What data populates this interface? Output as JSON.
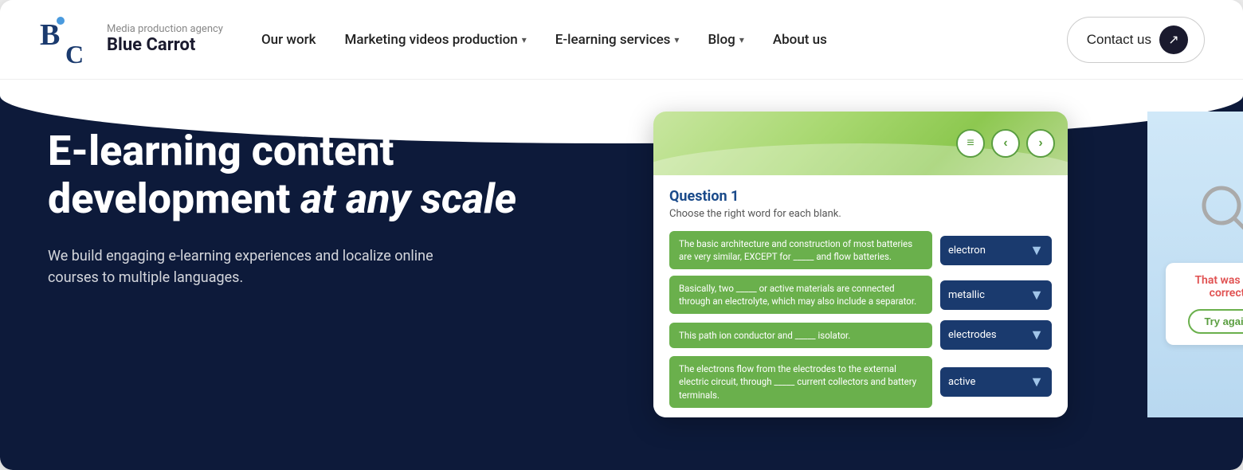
{
  "navbar": {
    "logo": {
      "subtitle": "Media production agency",
      "title": "Blue Carrot"
    },
    "links": [
      {
        "label": "Our work",
        "hasDropdown": false
      },
      {
        "label": "Marketing videos production",
        "hasDropdown": true
      },
      {
        "label": "E-learning services",
        "hasDropdown": true
      },
      {
        "label": "Blog",
        "hasDropdown": true
      },
      {
        "label": "About us",
        "hasDropdown": false
      }
    ],
    "contact_label": "Contact us",
    "contact_arrow": "→"
  },
  "hero": {
    "title_line1": "E-learning content",
    "title_line2": "development",
    "title_italic": "at any scale",
    "subtitle": "We build engaging e-learning experiences and localize online courses to multiple languages."
  },
  "widget": {
    "question_label": "Question 1",
    "instruction": "Choose the right word for each blank.",
    "rows": [
      {
        "text": "The basic architecture and construction of most batteries are very similar, EXCEPT for _____ and flow batteries.",
        "answer": "electron"
      },
      {
        "text": "Basically, two _____ or active materials are connected through an electrolyte, which may also include a separator.",
        "answer": "metallic"
      },
      {
        "text": "This path ion conductor and _____ isolator.",
        "answer": "electrodes"
      },
      {
        "text": "The electrons flow from the electrodes to the external electric circuit, through _____ current collectors and battery terminals.",
        "answer": "active"
      }
    ],
    "feedback": {
      "wrong_text": "That was not correct",
      "try_again_label": "Try again"
    },
    "nav": {
      "menu": "≡",
      "prev": "‹",
      "next": "›"
    }
  }
}
